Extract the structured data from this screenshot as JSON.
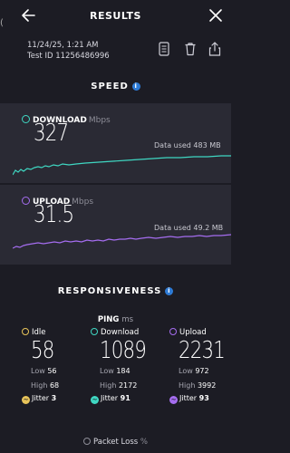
{
  "header": {
    "title": "RESULTS"
  },
  "test": {
    "date": "11/24/25, 1:21 AM",
    "id": "Test ID 11256486996"
  },
  "speed": {
    "title": "SPEED",
    "download": {
      "label": "DOWNLOAD",
      "unit": "Mbps",
      "value": "327",
      "data_used": "Data used 483 MB",
      "color": "#3fd7c2"
    },
    "upload": {
      "label": "UPLOAD",
      "unit": "Mbps",
      "value": "31.5",
      "data_used": "Data used 49.2 MB",
      "color": "#a56df0"
    }
  },
  "responsiveness": {
    "title": "RESPONSIVENESS",
    "ping_label": "PING",
    "ping_unit": "ms",
    "columns": [
      {
        "label": "Idle",
        "value": "58",
        "low_label": "Low",
        "low": "56",
        "high_label": "High",
        "high": "68",
        "jitter_label": "Jitter",
        "jitter": "3",
        "color": "#e8c45a"
      },
      {
        "label": "Download",
        "value": "1089",
        "low_label": "Low",
        "low": "184",
        "high_label": "High",
        "high": "2172",
        "jitter_label": "Jitter",
        "jitter": "91",
        "color": "#3fd7c2"
      },
      {
        "label": "Upload",
        "value": "2231",
        "low_label": "Low",
        "low": "972",
        "high_label": "High",
        "high": "3992",
        "jitter_label": "Jitter",
        "jitter": "93",
        "color": "#a56df0"
      }
    ]
  },
  "packet_loss": {
    "label": "Packet Loss",
    "unit": "%"
  }
}
